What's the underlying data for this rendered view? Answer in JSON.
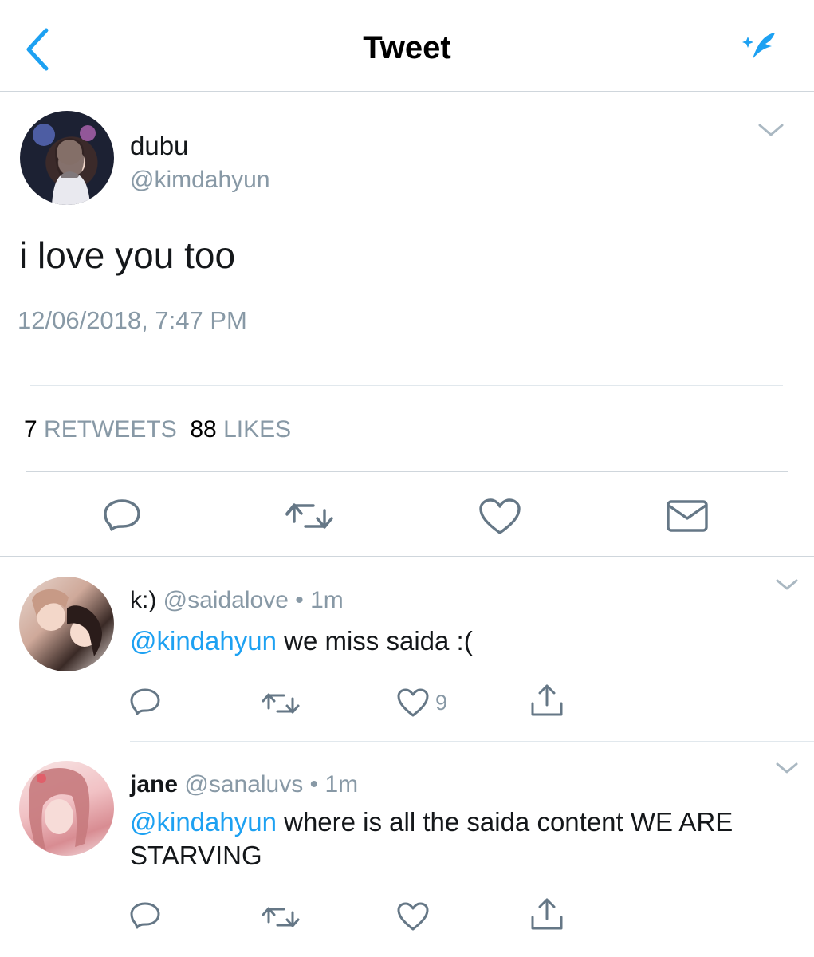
{
  "header": {
    "title": "Tweet",
    "back_icon": "chevron-left-icon",
    "compose_icon": "compose-feather-icon",
    "accent": "#1da1f2"
  },
  "main_tweet": {
    "display_name": "dubu",
    "handle": "@kimdahyun",
    "text": "i love you too",
    "timestamp": "12/06/2018, 7:47 PM",
    "retweet_count": "7",
    "retweet_label": "RETWEETS",
    "like_count": "88",
    "like_label": "LIKES",
    "actions": [
      "reply-icon",
      "retweet-icon",
      "like-icon",
      "direct-message-icon"
    ]
  },
  "replies": [
    {
      "display_name": "k:)",
      "handle": "@saidalove",
      "separator": "•",
      "time": "1m",
      "mention": "@kindahyun",
      "text": " we miss saida :(",
      "like_count": "9"
    },
    {
      "display_name": "jane",
      "handle": "@sanaluvs",
      "separator": "•",
      "time": "1m",
      "mention": "@kindahyun",
      "text": " where is all the saida content WE ARE STARVING",
      "like_count": ""
    }
  ]
}
